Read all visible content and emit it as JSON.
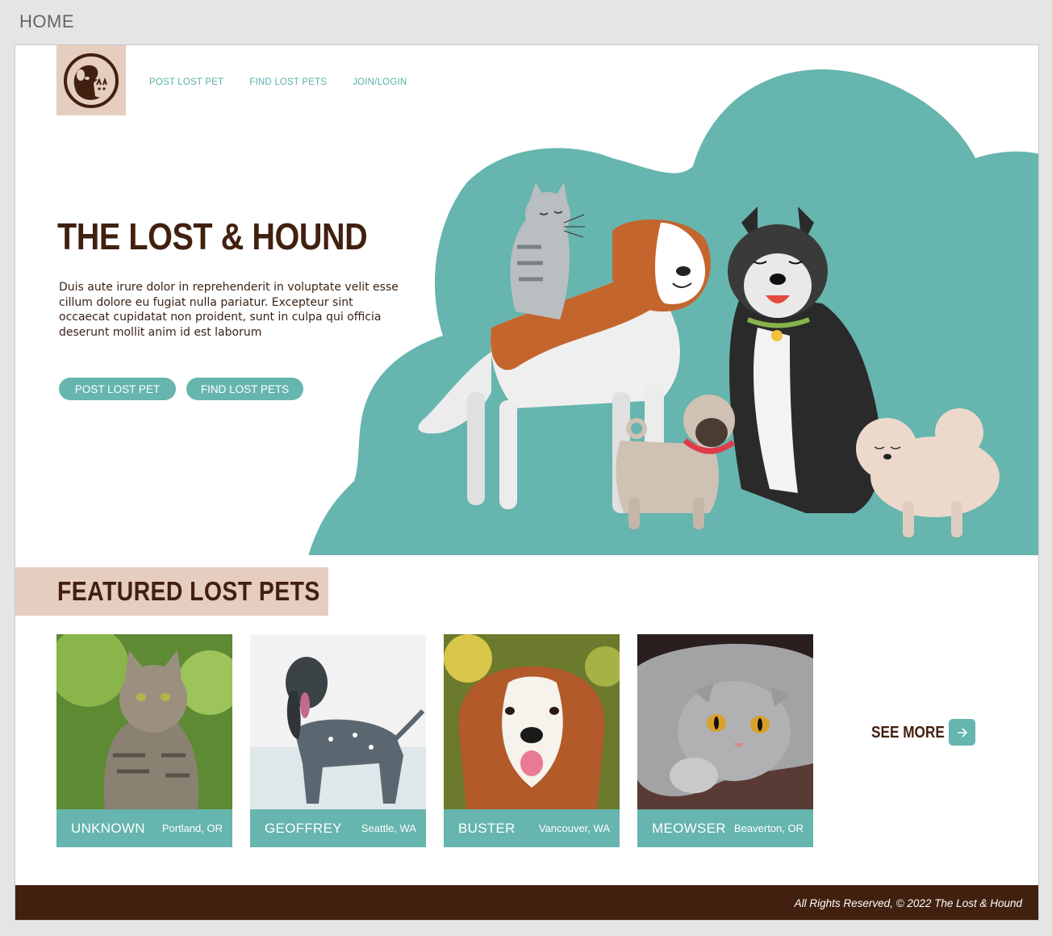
{
  "frame": {
    "label": "HOME"
  },
  "nav": {
    "items": [
      "POST LOST PET",
      "FIND LOST PETS",
      "JOIN/LOGIN"
    ]
  },
  "hero": {
    "title": "THE LOST & HOUND",
    "text": "Duis aute irure dolor in reprehenderit in voluptate velit esse cillum dolore eu fugiat nulla pariatur. Excepteur sint occaecat cupidatat non proident, sunt in culpa qui officia deserunt mollit anim id est laborum",
    "buttons": {
      "post": "POST LOST PET",
      "find": "FIND LOST PETS"
    },
    "illustration_icons": [
      "cat-icon",
      "saint-bernard-icon",
      "husky-icon",
      "pug-icon",
      "pomeranian-icon"
    ]
  },
  "featured": {
    "title": "FEATURED LOST PETS",
    "pets": [
      {
        "name": "UNKNOWN",
        "location": "Portland, OR",
        "kind": "tabby-cat"
      },
      {
        "name": "GEOFFREY",
        "location": "Seattle, WA",
        "kind": "setter-dog"
      },
      {
        "name": "BUSTER",
        "location": "Vancouver, WA",
        "kind": "collie-dog"
      },
      {
        "name": "MEOWSER",
        "location": "Beaverton, OR",
        "kind": "scottish-fold-cat"
      }
    ],
    "see_more": "SEE MORE",
    "arrow_icon": "arrow-right-icon"
  },
  "footer": {
    "text": "All Rights Reserved, © 2022 The Lost & Hound"
  },
  "colors": {
    "teal": "#66b5ae",
    "brown": "#42200f",
    "sand": "#e5cdbf"
  }
}
